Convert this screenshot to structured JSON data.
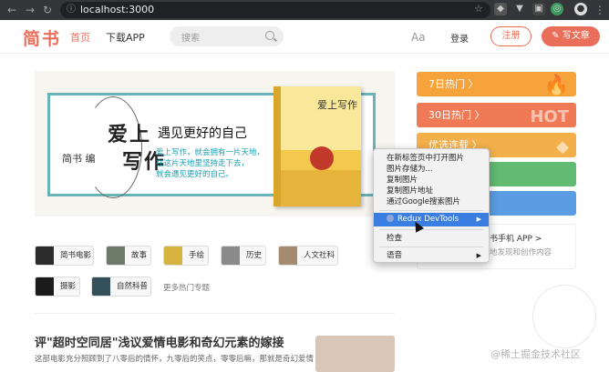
{
  "browser": {
    "url": "localhost:3000"
  },
  "nav": {
    "logo": "简书",
    "home": "首页",
    "download": "下载APP",
    "search_placeholder": "搜索",
    "aa": "Aa",
    "login": "登录",
    "register": "注册",
    "write": "写文章"
  },
  "banner": {
    "title_1": "爱上",
    "title_2": "写作",
    "publisher": "简书 编",
    "headline": "遇见更好的自己",
    "desc_1": "爱上写作，就会拥有一片天地，",
    "desc_2": "在这片天地里坚持走下去，",
    "desc_3": "就会遇见更好的自己。",
    "book_title": "爱上写作"
  },
  "side_cards": [
    {
      "label": "7日热门 〉",
      "color": "#f6a33c"
    },
    {
      "label": "30日热门 〉",
      "color": "#ef7a55",
      "badge": "HOT"
    },
    {
      "label": "优选连载 〉",
      "color": "#f3b04a"
    },
    {
      "label": "",
      "color": "#62bb73"
    },
    {
      "label": "",
      "color": "#5a9de3"
    }
  ],
  "app_promo": {
    "line1": "书手机 APP >",
    "line2": "地发现和创作内容"
  },
  "topics": [
    {
      "label": "简书电影",
      "color": "#2b2b2b"
    },
    {
      "label": "故事",
      "color": "#6d7a6a"
    },
    {
      "label": "手绘",
      "color": "#d6b23e"
    },
    {
      "label": "历史",
      "color": "#8a8a8a"
    },
    {
      "label": "人文社科",
      "color": "#a48b6f"
    },
    {
      "label": "摄影",
      "color": "#1b1b1b"
    },
    {
      "label": "自然科普",
      "color": "#34505a"
    }
  ],
  "more_topics": "更多热门专题",
  "article": {
    "title": "评\"超时空同居\"浅议爱情电影和奇幻元素的嫁接",
    "abstract": "这部电影充分照顾到了八零后的情怀，九零后的笑点，零零后嘛，那就是奇幻爱情"
  },
  "context_menu": {
    "items": [
      "在新标签页中打开图片",
      "图片存储为...",
      "复制图片",
      "复制图片地址",
      "通过Google搜索图片"
    ],
    "highlighted": "Redux DevTools",
    "inspect": "检查",
    "speech": "语音"
  },
  "watermark": "@稀土掘金技术社区"
}
